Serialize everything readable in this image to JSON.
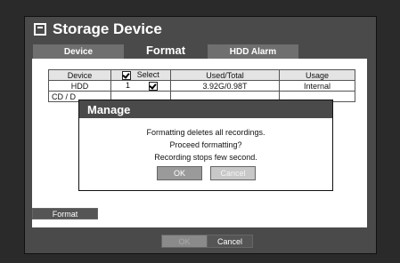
{
  "window": {
    "title": "Storage Device"
  },
  "tabs": [
    {
      "label": "Device",
      "active": false
    },
    {
      "label": "Format",
      "active": true
    },
    {
      "label": "HDD Alarm",
      "active": false
    }
  ],
  "table": {
    "headers": [
      "Device",
      "Select",
      "Used/Total",
      "Usage"
    ],
    "select_header_checked": true,
    "rows": [
      {
        "device": "HDD",
        "select": "1",
        "checked": true,
        "used_total": "3.92G/0.98T",
        "usage": "Internal"
      },
      {
        "device": "CD / D",
        "select": "",
        "checked": false,
        "used_total": "",
        "usage": ""
      }
    ]
  },
  "format_button": "Format",
  "footer": {
    "ok_label": "OK",
    "cancel_label": "Cancel"
  },
  "dialog": {
    "title": "Manage",
    "lines": [
      "Formatting deletes all recordings.",
      "Proceed formatting?",
      "Recording stops few second."
    ],
    "ok_label": "OK",
    "cancel_label": "Cancel"
  }
}
